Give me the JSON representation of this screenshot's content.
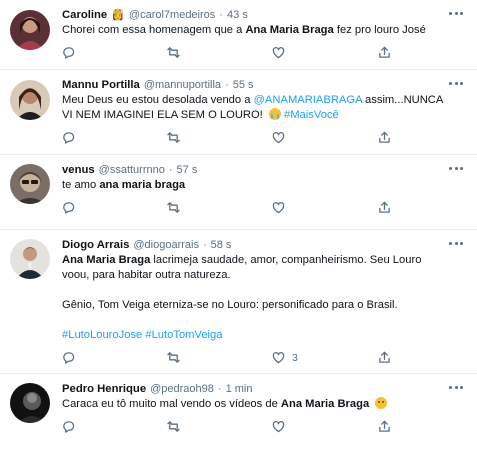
{
  "colors": {
    "link": "#1da1f2",
    "muted": "#5b7083",
    "divider": "#e6ecf0"
  },
  "tweets": [
    {
      "name": "Caroline",
      "badge_emoji": "👸",
      "handle": "@carol7medeiros",
      "separator": "·",
      "time": "43 s",
      "text": {
        "a": "Chorei com essa homenagem que a ",
        "b": "Ana Maria Braga",
        "c": " fez pro louro José"
      },
      "reply_count": "",
      "retweet_count": "",
      "like_count": ""
    },
    {
      "name": "Mannu Portilla",
      "handle": "@mannuportilla",
      "separator": "·",
      "time": "55 s",
      "text": {
        "a": "Meu Deus eu estou desolada vendo a ",
        "mention": "@ANAMARIABRAGA",
        "b": " assim...NUNCA",
        "c": "VI NEM IMAGINEI ELA SEM O LOURO! ",
        "emoji": "😭",
        "hashtag": "#MaisVocê"
      }
    },
    {
      "name": "venus",
      "handle": "@ssatturrnno",
      "separator": "·",
      "time": "57 s",
      "text": {
        "a": "te amo ",
        "b": "ana maria braga"
      }
    },
    {
      "name": "Diogo Arrais",
      "handle": "@diogoarrais",
      "separator": "·",
      "time": "58 s",
      "text": {
        "bold": "Ana Maria Braga",
        "a": " lacrimeja saudade, amor, companheirismo. Seu Louro",
        "b": "voou, para habitar outra natureza.",
        "c": "Gênio, Tom Veiga eterniza-se no Louro: personificado para o Brasil.",
        "hashtag1": "#LutoLouroJose",
        "hashtag2": "#LutoTomVeiga"
      },
      "like_count": "3"
    },
    {
      "name": "Pedro Henrique",
      "handle": "@pedraoh98",
      "separator": "·",
      "time": "1 min",
      "text": {
        "a": "Caraca eu tô muito mal vendo os vídeos de ",
        "b": "Ana Maria Braga",
        "emoji": "☹️"
      }
    }
  ],
  "icons": [
    "reply-icon",
    "retweet-icon",
    "like-icon",
    "share-icon",
    "more-icon"
  ]
}
